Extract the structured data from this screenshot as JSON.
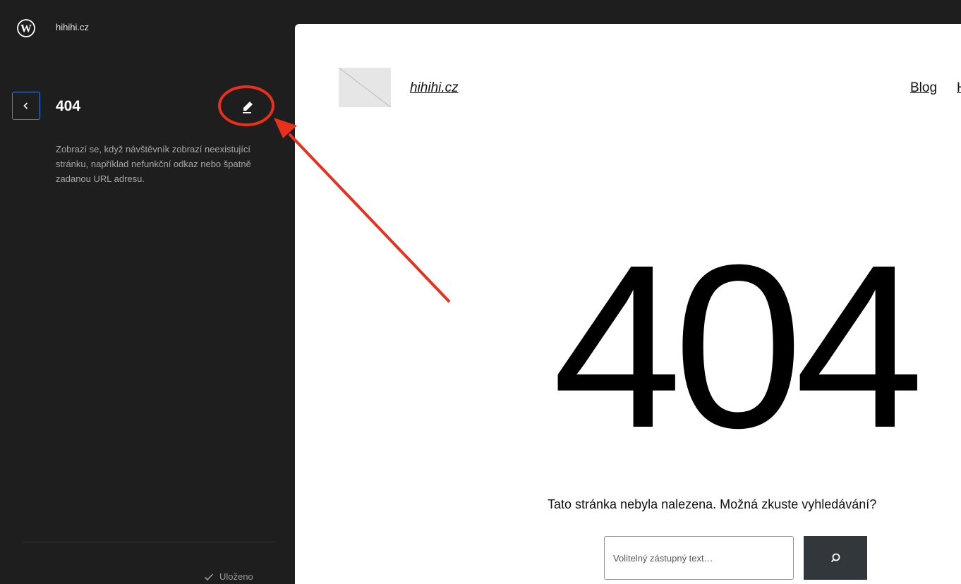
{
  "sidebar": {
    "site_name": "hihihi.cz",
    "template_title": "404",
    "template_description": "Zobrazí se, když návštěvník zobrazí neexistující stránku, například nefunkční odkaz nebo špatně zadanou URL adresu.",
    "status": "Uloženo"
  },
  "canvas": {
    "site_title": "hihihi.cz",
    "nav": [
      "Blog",
      "H"
    ],
    "heading": "404",
    "message": "Tato stránka nebyla nalezena. Možná zkuste vyhledávání?",
    "search": {
      "placeholder": "Volitelný zástupný text…"
    }
  },
  "colors": {
    "sidebar_bg": "#1e1e1e",
    "accent": "#3a83d4",
    "annotation": "#e8301c",
    "search_button": "#32373c"
  }
}
